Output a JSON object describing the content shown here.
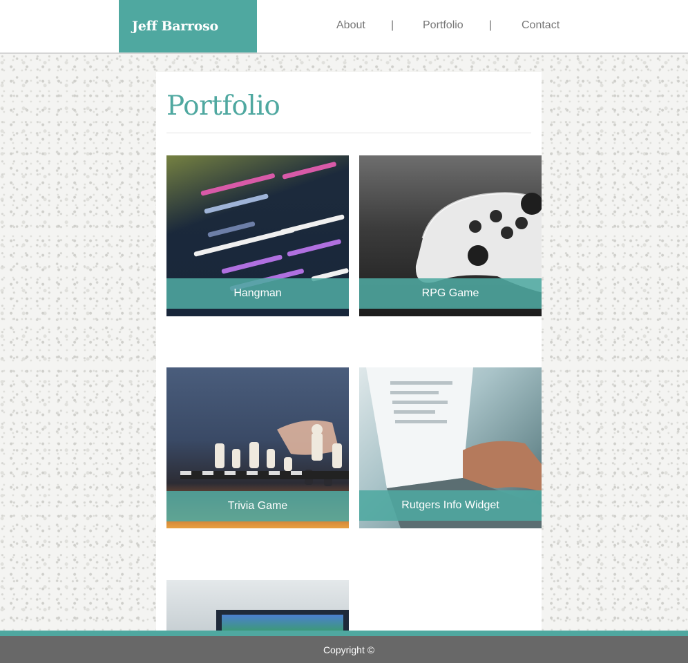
{
  "header": {
    "brand": "Jeff Barroso",
    "nav": [
      {
        "label": "About"
      },
      {
        "label": "Portfolio"
      },
      {
        "label": "Contact"
      }
    ],
    "separator": "|"
  },
  "main": {
    "title": "Portfolio",
    "projects": [
      {
        "title": "Hangman",
        "image": "code-screen-photo"
      },
      {
        "title": "RPG Game",
        "image": "game-controller-photo"
      },
      {
        "title": "Trivia Game",
        "image": "chess-photo"
      },
      {
        "title": "Rutgers Info Widget",
        "image": "laptop-typing-photo"
      },
      {
        "title": "",
        "image": "tv-screen-photo"
      }
    ]
  },
  "footer": {
    "copyright": "Copyright ©"
  },
  "colors": {
    "accent": "#4fa8a0",
    "footer_bg": "#686868",
    "nav_text": "#777777"
  }
}
